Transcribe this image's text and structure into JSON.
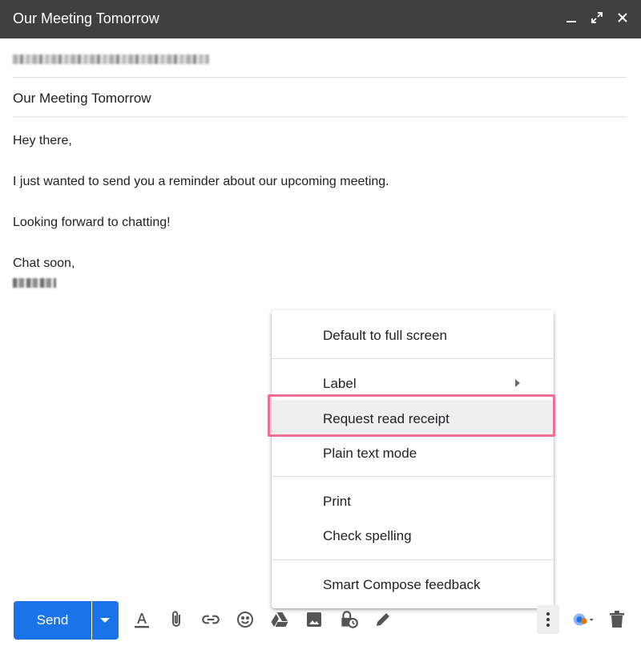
{
  "window": {
    "title": "Our Meeting Tomorrow"
  },
  "subject": "Our Meeting Tomorrow",
  "body": {
    "greeting": "Hey there,",
    "line1": "I just wanted to send you a reminder about our upcoming meeting.",
    "line2": "Looking forward to chatting!",
    "signoff": "Chat soon,"
  },
  "menu": {
    "items": [
      {
        "label": "Default to full screen"
      },
      {
        "label": "Label"
      },
      {
        "label": "Request read receipt"
      },
      {
        "label": "Plain text mode"
      },
      {
        "label": "Print"
      },
      {
        "label": "Check spelling"
      },
      {
        "label": "Smart Compose feedback"
      }
    ]
  },
  "toolbar": {
    "send_label": "Send",
    "icons": [
      "format-text-icon",
      "attach-icon",
      "link-icon",
      "emoji-icon",
      "drive-icon",
      "photo-icon",
      "confidential-icon",
      "signature-icon",
      "more-options-icon",
      "assistant-icon",
      "trash-icon"
    ]
  },
  "colors": {
    "titlebar": "#404040",
    "send": "#1a73e8",
    "highlight_outline": "#f06e94"
  }
}
